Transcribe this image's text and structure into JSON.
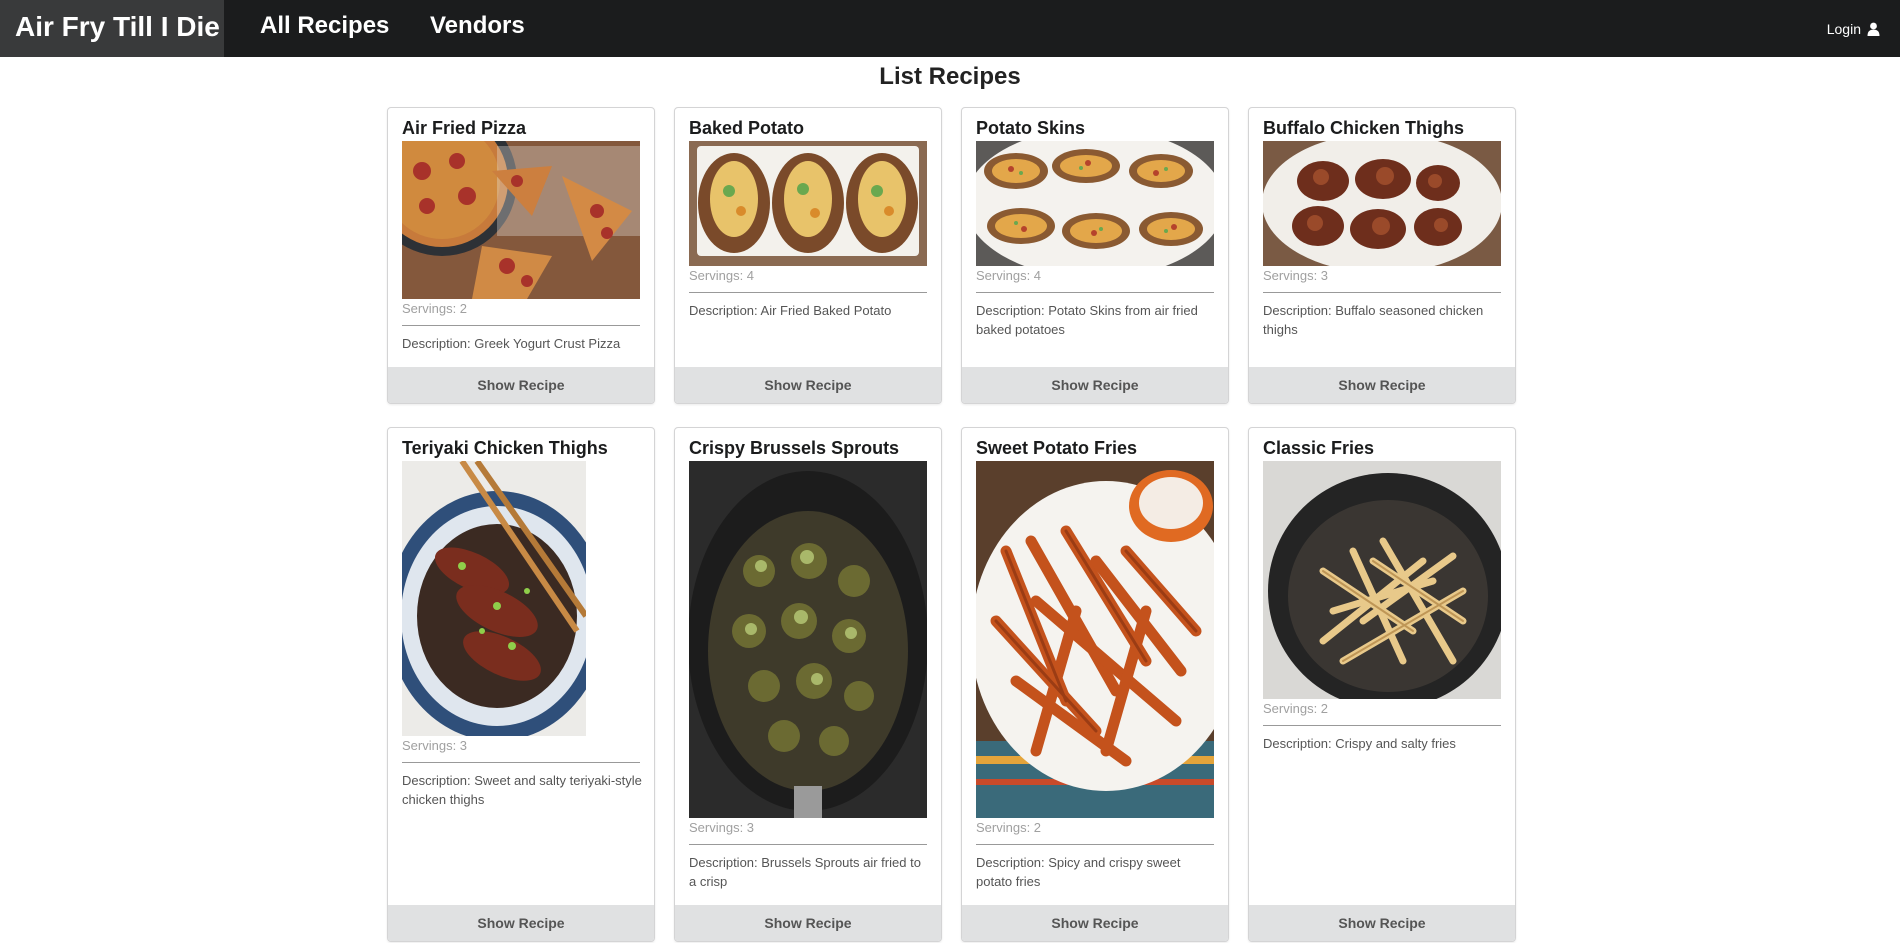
{
  "navbar": {
    "brand": "Air Fry Till I Die",
    "links": [
      "All Recipes",
      "Vendors"
    ],
    "login_label": "Login",
    "login_icon": "user-icon"
  },
  "page_title": "List Recipes",
  "recipes": [
    {
      "title": "Air Fried Pizza",
      "servings": "Servings: 2",
      "description": "Description: Greek Yogurt Crust Pizza",
      "button": "Show Recipe"
    },
    {
      "title": "Baked Potato",
      "servings": "Servings: 4",
      "description": "Description: Air Fried Baked Potato",
      "button": "Show Recipe"
    },
    {
      "title": "Potato Skins",
      "servings": "Servings: 4",
      "description": "Description: Potato Skins from air fried baked potatoes",
      "button": "Show Recipe"
    },
    {
      "title": "Buffalo Chicken Thighs",
      "servings": "Servings: 3",
      "description": "Description: Buffalo seasoned chicken thighs",
      "button": "Show Recipe"
    },
    {
      "title": "Teriyaki Chicken Thighs",
      "servings": "Servings: 3",
      "description": "Description: Sweet and salty teriyaki-style chicken thighs",
      "button": "Show Recipe"
    },
    {
      "title": "Crispy Brussels Sprouts",
      "servings": "Servings: 3",
      "description": "Description: Brussels Sprouts air fried to a crisp",
      "button": "Show Recipe"
    },
    {
      "title": "Sweet Potato Fries",
      "servings": "Servings: 2",
      "description": "Description: Spicy and crispy sweet potato fries",
      "button": "Show Recipe"
    },
    {
      "title": "Classic Fries",
      "servings": "Servings: 2",
      "description": "Description: Crispy and salty fries",
      "button": "Show Recipe"
    }
  ],
  "colors": {
    "navbar_bg": "#1b1c1d",
    "brand_bg": "#393a3b",
    "button_bg": "#e0e1e2"
  }
}
